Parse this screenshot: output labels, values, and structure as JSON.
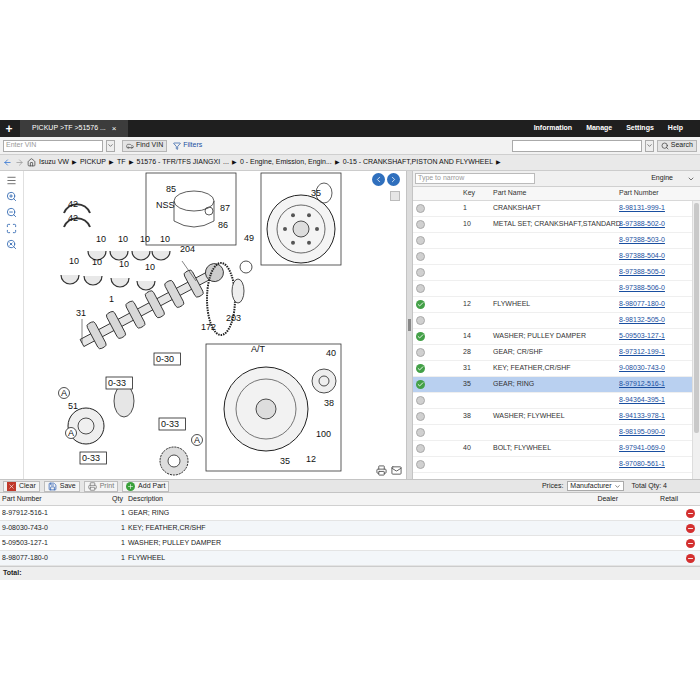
{
  "top_bar": {
    "new_tab": "+",
    "tab": {
      "label": "PICKUP >TF >51576 ...",
      "close": "×",
      "selected": true
    },
    "menu": [
      "Information",
      "Manage",
      "Settings",
      "Help"
    ]
  },
  "toolbar": {
    "vin_placeholder": "Enter VIN",
    "find_vin": "Find VIN",
    "filters": "Filters",
    "search": "Search"
  },
  "breadcrumb": {
    "separator": "▶",
    "items": [
      {
        "label": "Isuzu VW",
        "arrow": true
      },
      {
        "label": "PICKUP",
        "arrow": true
      },
      {
        "label": "TF",
        "arrow": true
      },
      {
        "label": "51576 - TFR/TFS JIANGXI",
        "arrow": false
      },
      {
        "label": "...",
        "arrow": true
      },
      {
        "label": "0 - Engine, Emission, Engin...",
        "arrow": true
      },
      {
        "label": "0-15 - CRANKSHAFT,PISTON AND FLYWHEEL",
        "arrow": true
      }
    ]
  },
  "diagram": {
    "labels": [
      {
        "text": "85",
        "kind": "plain"
      },
      {
        "text": "42",
        "kind": "plain"
      },
      {
        "text": "42",
        "kind": "plain"
      },
      {
        "text": "NSS",
        "kind": "plain"
      },
      {
        "text": "87",
        "kind": "plain"
      },
      {
        "text": "86",
        "kind": "plain"
      },
      {
        "text": "10",
        "kind": "plain"
      },
      {
        "text": "10",
        "kind": "plain"
      },
      {
        "text": "10",
        "kind": "plain"
      },
      {
        "text": "10",
        "kind": "plain"
      },
      {
        "text": "10",
        "kind": "plain"
      },
      {
        "text": "10",
        "kind": "plain"
      },
      {
        "text": "10",
        "kind": "plain"
      },
      {
        "text": "10",
        "kind": "plain"
      },
      {
        "text": "204",
        "kind": "plain"
      },
      {
        "text": "49",
        "kind": "plain"
      },
      {
        "text": "1",
        "kind": "plain"
      },
      {
        "text": "172",
        "kind": "plain"
      },
      {
        "text": "203",
        "kind": "plain"
      },
      {
        "text": "35",
        "kind": "plain"
      },
      {
        "text": "31",
        "kind": "plain"
      },
      {
        "text": "0-30",
        "kind": "boxed"
      },
      {
        "text": "0-33",
        "kind": "boxed"
      },
      {
        "text": "0-33",
        "kind": "boxed"
      },
      {
        "text": "0-33",
        "kind": "boxed"
      },
      {
        "text": "51",
        "kind": "plain"
      },
      {
        "text": "A",
        "kind": "circled"
      },
      {
        "text": "A",
        "kind": "circled"
      },
      {
        "text": "A",
        "kind": "circled"
      },
      {
        "text": "A/T",
        "kind": "plain"
      },
      {
        "text": "40",
        "kind": "plain"
      },
      {
        "text": "38",
        "kind": "plain"
      },
      {
        "text": "100",
        "kind": "plain"
      },
      {
        "text": "35",
        "kind": "plain"
      },
      {
        "text": "12",
        "kind": "plain"
      }
    ]
  },
  "parts_panel": {
    "filter_placeholder": "Type to narrow",
    "group": "Engine",
    "columns": [
      "Key",
      "Part Name",
      "Part Number"
    ],
    "rows": [
      {
        "key": "1",
        "name": "CRANKSHAFT",
        "number": "8-98131-999-1",
        "added": false,
        "selected": false
      },
      {
        "key": "10",
        "name": "METAL SET; CRANKSHAFT,STANDARD",
        "number": "8-97388-502-0",
        "added": false,
        "selected": false
      },
      {
        "key": "",
        "name": "",
        "number": "8-97388-503-0",
        "added": false,
        "selected": false
      },
      {
        "key": "",
        "name": "",
        "number": "8-97388-504-0",
        "added": false,
        "selected": false
      },
      {
        "key": "",
        "name": "",
        "number": "8-97388-505-0",
        "added": false,
        "selected": false
      },
      {
        "key": "",
        "name": "",
        "number": "8-97388-506-0",
        "added": false,
        "selected": false
      },
      {
        "key": "12",
        "name": "FLYWHEEL",
        "number": "8-98077-180-0",
        "added": true,
        "selected": false
      },
      {
        "key": "",
        "name": "",
        "number": "8-98132-505-0",
        "added": false,
        "selected": false
      },
      {
        "key": "14",
        "name": "WASHER; PULLEY DAMPER",
        "number": "5-09503-127-1",
        "added": true,
        "selected": false
      },
      {
        "key": "28",
        "name": "GEAR; CR/SHF",
        "number": "8-97312-199-1",
        "added": false,
        "selected": false
      },
      {
        "key": "31",
        "name": "KEY; FEATHER,CR/SHF",
        "number": "9-08030-743-0",
        "added": true,
        "selected": false
      },
      {
        "key": "35",
        "name": "GEAR; RING",
        "number": "8-97912-516-1",
        "added": true,
        "selected": true
      },
      {
        "key": "",
        "name": "",
        "number": "8-94364-395-1",
        "added": false,
        "selected": false
      },
      {
        "key": "38",
        "name": "WASHER; FLYWHEEL",
        "number": "8-94133-978-1",
        "added": false,
        "selected": false
      },
      {
        "key": "",
        "name": "",
        "number": "8-98195-090-0",
        "added": false,
        "selected": false
      },
      {
        "key": "40",
        "name": "BOLT; FLYWHEEL",
        "number": "8-97941-069-0",
        "added": false,
        "selected": false
      },
      {
        "key": "",
        "name": "",
        "number": "8-97080-561-1",
        "added": false,
        "selected": false
      }
    ]
  },
  "list_toolbar": {
    "buttons": [
      {
        "label": "Clear",
        "kind": "clear",
        "disabled": false
      },
      {
        "label": "Save",
        "kind": "save",
        "disabled": false
      },
      {
        "label": "Print",
        "kind": "print",
        "disabled": true
      },
      {
        "label": "Add Part",
        "kind": "add",
        "disabled": false
      }
    ],
    "prices_label": "Prices:",
    "prices_value": "Manufacturer",
    "total_qty": "Total Qty: 4"
  },
  "list": {
    "columns": [
      "Part Number",
      "Qty",
      "Description",
      "Dealer",
      "Retail"
    ],
    "rows": [
      {
        "number": "8-97912-516-1",
        "qty": "1",
        "description": "GEAR; RING",
        "dealer": "",
        "retail": ""
      },
      {
        "number": "9-08030-743-0",
        "qty": "1",
        "description": "KEY; FEATHER,CR/SHF",
        "dealer": "",
        "retail": ""
      },
      {
        "number": "5-09503-127-1",
        "qty": "1",
        "description": "WASHER; PULLEY DAMPER",
        "dealer": "",
        "retail": ""
      },
      {
        "number": "8-98077-180-0",
        "qty": "1",
        "description": "FLYWHEEL",
        "dealer": "",
        "retail": ""
      }
    ],
    "total": "Total:"
  }
}
